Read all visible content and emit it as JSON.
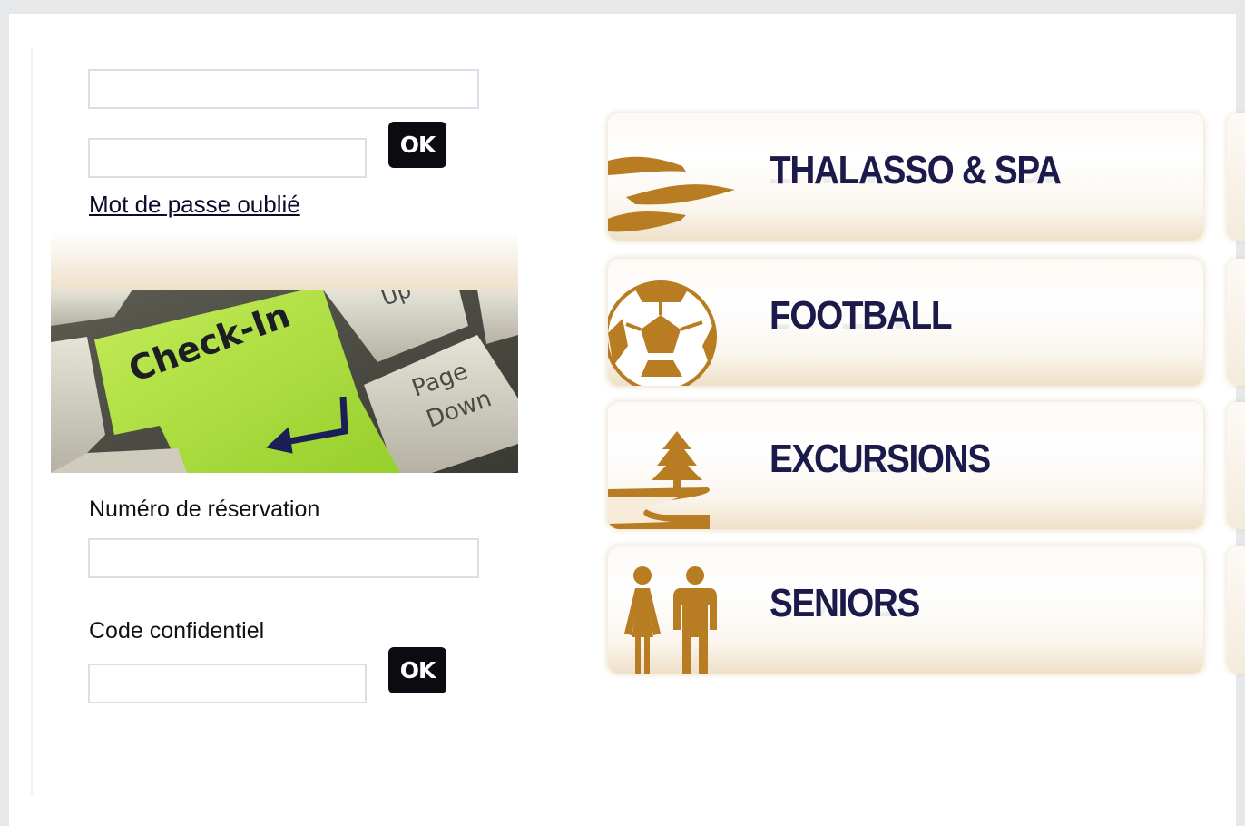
{
  "login": {
    "username_value": "",
    "password_value": "",
    "ok_label": "OK",
    "forgot_password": "Mot de passe oublié"
  },
  "checkin_image": {
    "key_label": "Check-In",
    "up_label": "Up",
    "pagedown_line1": "Page",
    "pagedown_line2": "Down"
  },
  "reservation": {
    "number_label": "Numéro de réservation",
    "number_value": "",
    "code_label": "Code confidentiel",
    "code_value": "",
    "ok_label": "OK"
  },
  "menu": [
    {
      "title": "THALASSO & SPA",
      "icon": "waves-icon"
    },
    {
      "title": "FOOTBALL",
      "icon": "soccer-ball-icon"
    },
    {
      "title": "EXCURSIONS",
      "icon": "tree-path-icon"
    },
    {
      "title": "SENIORS",
      "icon": "couple-icon"
    }
  ],
  "colors": {
    "accent_gold": "#b87c22",
    "title_navy": "#1c1a4a",
    "button_black": "#0b0b12",
    "key_green": "#a8dc3c"
  }
}
